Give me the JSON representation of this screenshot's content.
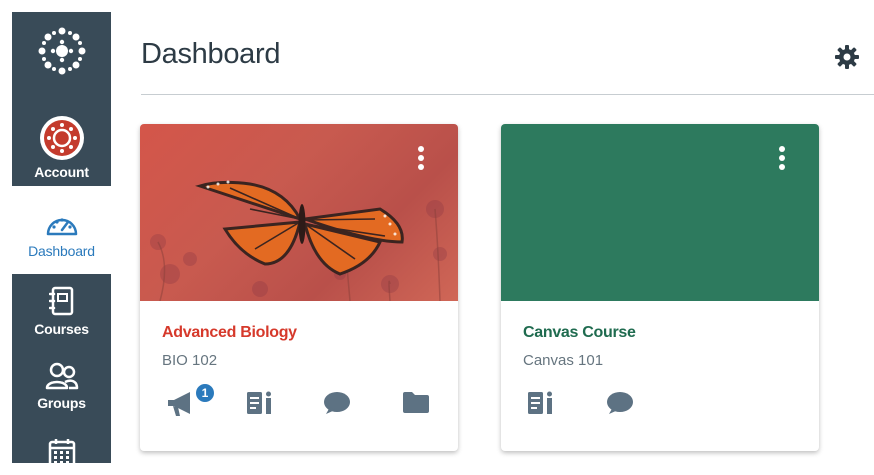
{
  "global_nav": {
    "logo_icon": "canvas-logo-icon",
    "items": [
      {
        "label": "Account",
        "icon": "avatar-icon"
      },
      {
        "label": "Dashboard",
        "icon": "dashboard-gauge-icon",
        "active": true
      },
      {
        "label": "Courses",
        "icon": "courses-book-icon"
      },
      {
        "label": "Groups",
        "icon": "groups-people-icon"
      },
      {
        "label": "",
        "icon": "calendar-icon"
      }
    ]
  },
  "header": {
    "title": "Dashboard",
    "settings_icon": "gear-icon"
  },
  "cards": [
    {
      "title": "Advanced Biology",
      "code": "BIO 102",
      "title_color": "#d6392b",
      "hero_color": "#c85a4f",
      "announcement_badge": "1",
      "icons": [
        "announcements-megaphone-icon",
        "assignments-icon",
        "discussions-icon",
        "files-folder-icon"
      ]
    },
    {
      "title": "Canvas Course",
      "code": "Canvas 101",
      "title_color": "#1f6b4f",
      "hero_color": "#2d7a5e",
      "icons": [
        "assignments-icon",
        "discussions-icon"
      ]
    }
  ],
  "colors": {
    "nav_bg": "#394b58",
    "accent_blue": "#2b7abc",
    "icon_gray": "#5d7283"
  }
}
